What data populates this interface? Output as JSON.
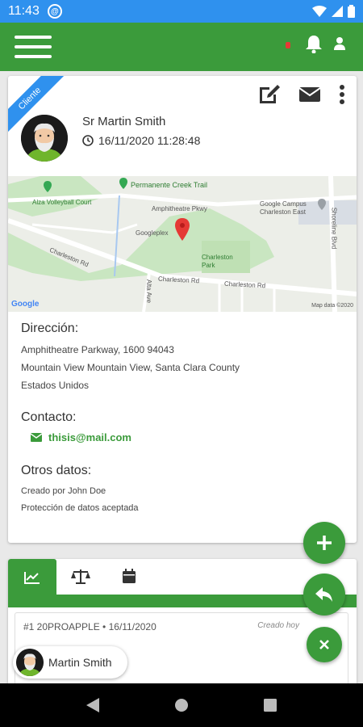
{
  "status_bar": {
    "time": "11:43",
    "sync_glyph": "@"
  },
  "app_bar": {
    "menu_icon": "hamburger-icon",
    "notification_icon": "bell-icon",
    "profile_icon": "person-icon",
    "brand_color": "#3b9b3b"
  },
  "card": {
    "ribbon": "Cliente",
    "actions": [
      "edit-icon",
      "mail-icon",
      "more-vert-icon"
    ],
    "name": "Sr Martin Smith",
    "datetime": "16/11/2020 11:28:48",
    "map": {
      "labels": {
        "trail": "Permanente Creek Trail",
        "court": "Alza Volleyball Court",
        "pkwy": "Amphitheatre Pkwy",
        "campus": "Google Campus Charleston East",
        "googleplex": "Googleplex",
        "park": "Charleston Park",
        "rd1": "Charleston Rd",
        "rd2": "Charleston Rd",
        "rd3": "Charleston Rd",
        "shoreline": "Shoreline Blvd",
        "alta": "Alta Ave",
        "attribution": "Map data ©2020",
        "logo": "Google"
      }
    },
    "address": {
      "title": "Dirección:",
      "lines": [
        "Amphitheatre Parkway, 1600 94043",
        "Mountain View Mountain View, Santa Clara County",
        "Estados Unidos"
      ]
    },
    "contact": {
      "title": "Contacto:",
      "email": "thisis@mail.com"
    },
    "other": {
      "title": "Otros datos:",
      "lines": [
        "Creado por John Doe",
        "Protección de datos aceptada"
      ]
    }
  },
  "tabs": {
    "items": [
      "chart-icon",
      "scale-icon",
      "calendar-icon"
    ],
    "active": 0
  },
  "list_item": {
    "title": "#1 20PROAPPLE • 16/11/2020",
    "meta": "Creado hoy"
  },
  "chip": {
    "name": "Martin Smith"
  },
  "fabs": [
    "add-icon",
    "reply-icon",
    "close-icon"
  ],
  "nav_bar": [
    "back-icon",
    "home-icon",
    "recents-icon"
  ]
}
